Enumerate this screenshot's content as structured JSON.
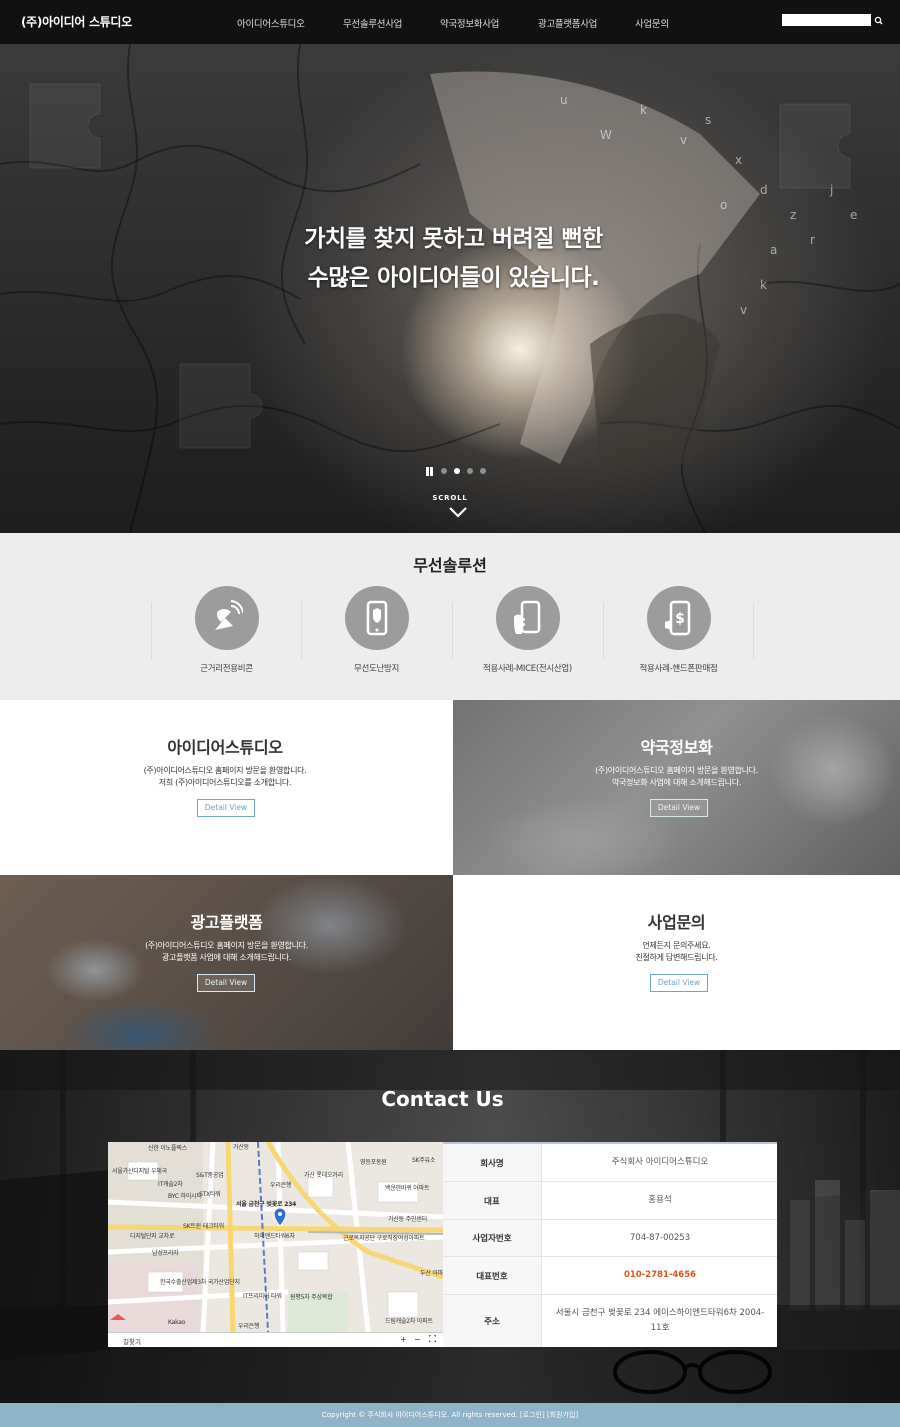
{
  "header": {
    "logo": "(주)아이디어 스튜디오",
    "nav": [
      "아이디어스튜디오",
      "무선솔루션사업",
      "약국정보화사업",
      "광고플랫폼사업",
      "사업문의"
    ]
  },
  "hero": {
    "line1": "가치를 찾지 못하고 버려질 뻔한",
    "line2": "수많은 아이디어들이 있습니다.",
    "scroll": "SCROLL",
    "slides_total": 4,
    "active_slide": 2
  },
  "solution": {
    "title": "무선솔루션",
    "items": [
      {
        "label": "근거리전용비콘",
        "icon": "satellite-dish-icon"
      },
      {
        "label": "무선도난방지",
        "icon": "phone-shield-icon"
      },
      {
        "label": "적용사례-MICE(전시산업)",
        "icon": "hand-phone-icon"
      },
      {
        "label": "적용사례-핸드폰판매점",
        "icon": "phone-dollar-icon"
      }
    ]
  },
  "tiles": [
    {
      "title": "아이디어스튜디오",
      "desc1": "(주)아이디어스튜디오 홈페이지 방문을 환영합니다.",
      "desc2": "저희 (주)아이디어스튜디오를 소개합니다.",
      "button": "Detail View"
    },
    {
      "title": "약국정보화",
      "desc1": "(주)아이디어스튜디오 홈페이지 방문을 환영합니다.",
      "desc2": "약국정보화 사업에 대해 소개해드립니다.",
      "button": "Detail View"
    },
    {
      "title": "광고플랫폼",
      "desc1": "(주)아이디어스튜디오 홈페이지 방문을 환영합니다.",
      "desc2": "광고플랫폼 사업에 대해 소개해드립니다.",
      "button": "Detail View"
    },
    {
      "title": "사업문의",
      "desc1": "언제든지 문의주세요.",
      "desc2": "친절하게 답변해드립니다.",
      "button": "Detail View"
    }
  ],
  "contact": {
    "title": "Contact Us",
    "map": {
      "road_label": "길찾기",
      "zoom_in": "+",
      "zoom_out": "−",
      "labels": [
        "신한 이노플렉스",
        "가산동",
        "서울가산디지털 우체국",
        "S&T중공업",
        "우리은행",
        "가산 롯데오거리",
        "영등포동원",
        "SK주유소",
        "IT캐슬2차",
        "BYC 하이시티",
        "STX타워",
        "서울 금천구 벚꽃로 234",
        "백운한바퀴 아파트",
        "SK트윈 테크타워",
        "가산동 주민센터",
        "디지털단지 교차로",
        "하이엔드타워6차",
        "남성프라자",
        "근로복지공단 구로직장여성아파트",
        "한국수출산업제3차 국가산업단지",
        "IT프리미어 타워",
        "원평5차 주상복합",
        "두산 아파트",
        "우리은행",
        "드림캐슬2차 아파트",
        "Kakao"
      ]
    },
    "rows": [
      {
        "key": "회사명",
        "value": "주식회사 아이디어스튜디오"
      },
      {
        "key": "대표",
        "value": "홍용석"
      },
      {
        "key": "사업자번호",
        "value": "704-87-00253"
      },
      {
        "key": "대표번호",
        "value": "010-2781-4656"
      },
      {
        "key": "주소",
        "value": "서울시 금천구 벚꽃로 234 에이스하이엔드타워6차 2004-11호"
      }
    ]
  },
  "footer": {
    "copyright": "Copyright © 주식회사 아이디어스튜디오. All rights reserved.",
    "login": "[로그인]",
    "join": "[회원가입]"
  },
  "colors": {
    "header_bg": "#111111",
    "button_accent": "#6ea5c4",
    "phone_highlight": "#e0541b",
    "footer_bg": "#8fb3c7"
  }
}
